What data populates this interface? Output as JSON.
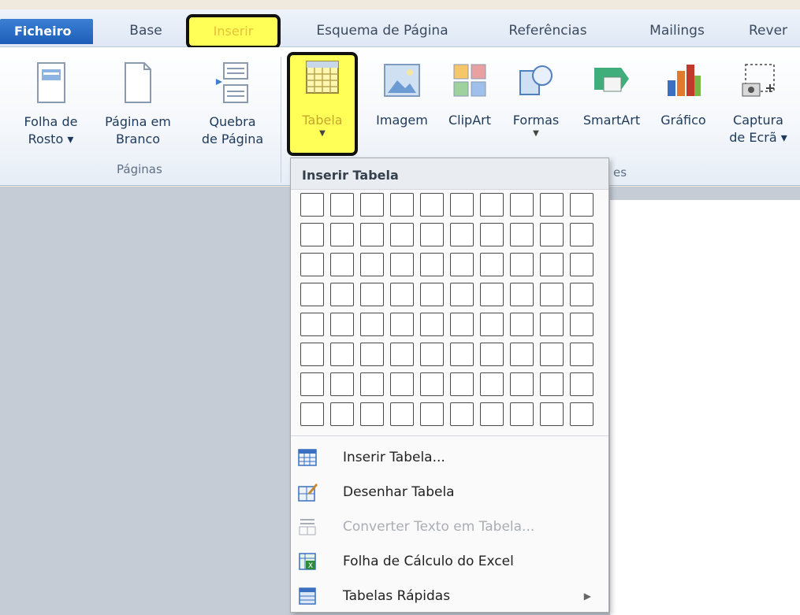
{
  "tabs": {
    "file": "Ficheiro",
    "base": "Base",
    "inserir": "Inserir",
    "esquema": "Esquema de Página",
    "referencias": "Referências",
    "mailings": "Mailings",
    "rever": "Rever"
  },
  "ribbon": {
    "folha_rosto": "Folha de\nRosto ▾",
    "pagina_branco": "Página em\nBranco",
    "quebra_pagina": "Quebra\nde Página",
    "paginas_group": "Páginas",
    "tabela": "Tabela",
    "imagem": "Imagem",
    "clipart": "ClipArt",
    "formas": "Formas",
    "smartart": "SmartArt",
    "grafico": "Gráfico",
    "captura": "Captura\nde Ecrã ▾",
    "ilustracoes_group_partial": "es"
  },
  "dropdown": {
    "header": "Inserir Tabela",
    "items": [
      {
        "label": "Inserir Tabela...",
        "enabled": true,
        "icon": "insert-table-icon"
      },
      {
        "label": "Desenhar Tabela",
        "enabled": true,
        "icon": "draw-table-icon"
      },
      {
        "label": "Converter Texto em Tabela...",
        "enabled": false,
        "icon": "convert-text-icon"
      },
      {
        "label": "Folha de Cálculo do Excel",
        "enabled": true,
        "icon": "excel-sheet-icon"
      },
      {
        "label": "Tabelas Rápidas",
        "enabled": true,
        "icon": "quick-tables-icon",
        "submenu": true
      }
    ]
  },
  "colors": {
    "highlight": "#ffff57",
    "file_tab": "#2b6fc8",
    "ribbon_text": "#1e395b"
  }
}
